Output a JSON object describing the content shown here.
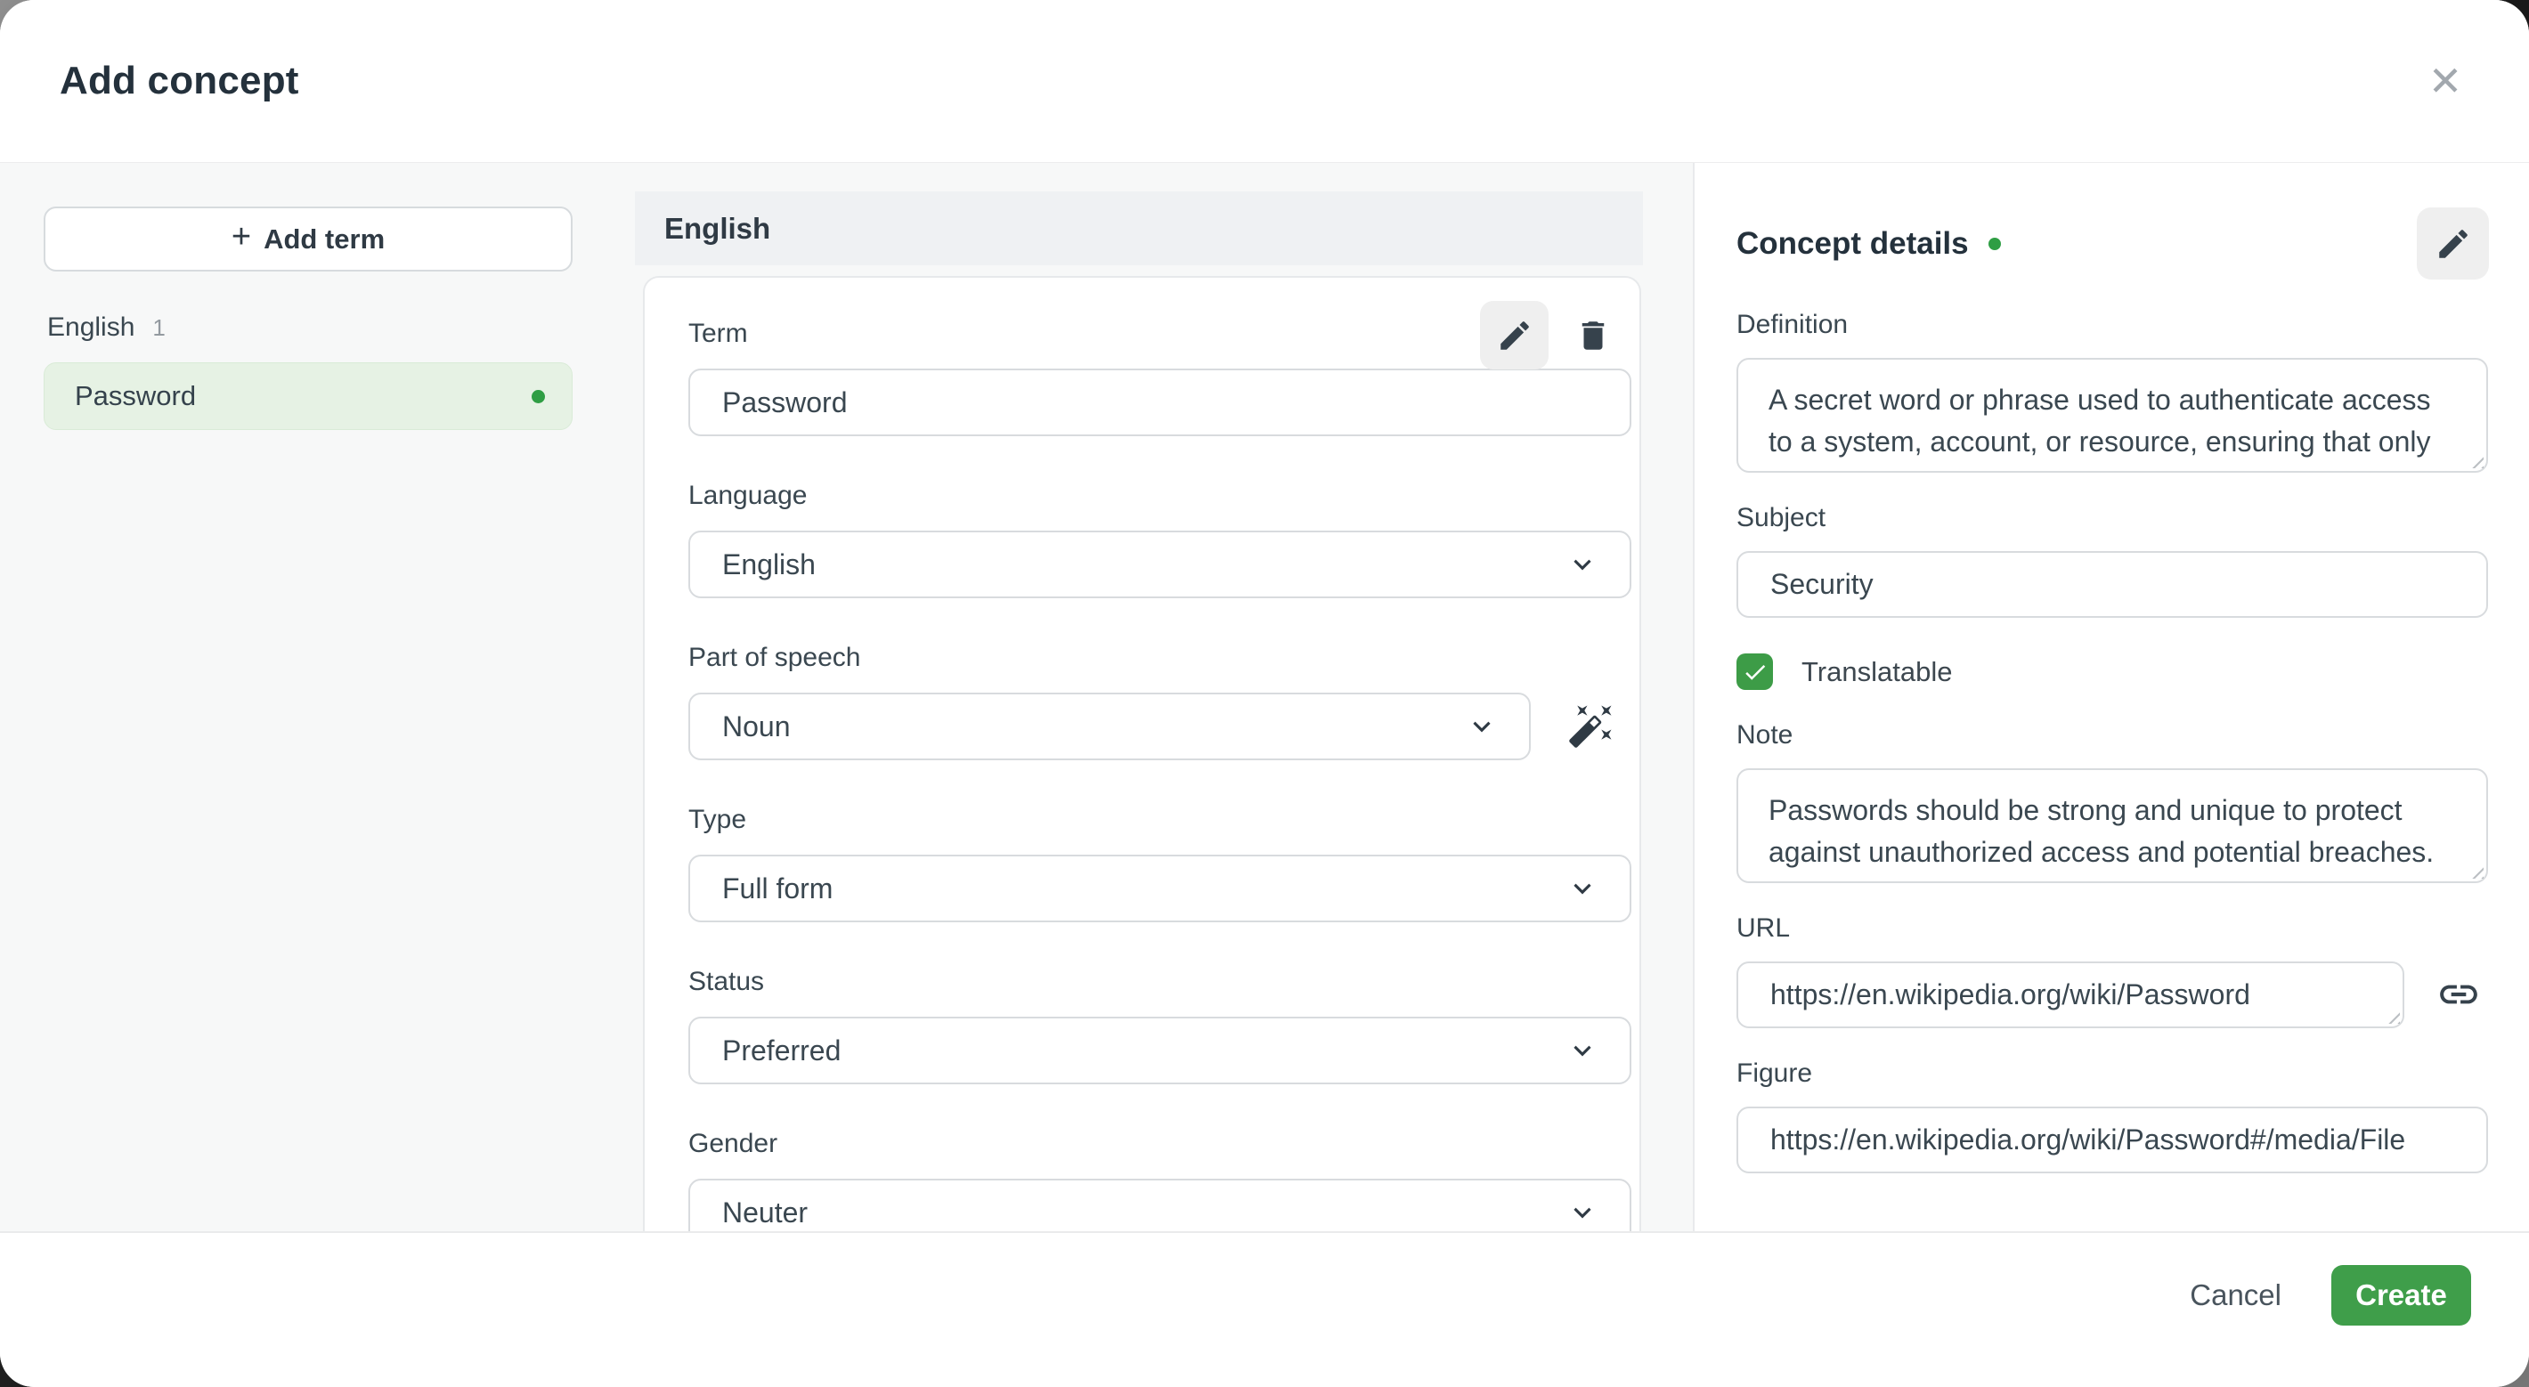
{
  "dialog": {
    "title": "Add concept",
    "close_glyph": "✕"
  },
  "sidebar": {
    "add_term": {
      "icon": "+",
      "label": "Add term"
    },
    "group": {
      "language": "English",
      "count": "1"
    },
    "terms": [
      {
        "label": "Password"
      }
    ]
  },
  "term_editor": {
    "header": "English",
    "term": {
      "label": "Term",
      "value": "Password"
    },
    "language": {
      "label": "Language",
      "value": "English"
    },
    "part_of_speech": {
      "label": "Part of speech",
      "value": "Noun"
    },
    "type": {
      "label": "Type",
      "value": "Full form"
    },
    "status": {
      "label": "Status",
      "value": "Preferred"
    },
    "gender": {
      "label": "Gender",
      "value": "Neuter"
    }
  },
  "concept_details": {
    "title": "Concept details",
    "definition": {
      "label": "Definition",
      "value": "A secret word or phrase used to authenticate access to a system, account, or resource, ensuring that only authorized users can gain entry."
    },
    "subject": {
      "label": "Subject",
      "value": "Security"
    },
    "translatable": {
      "label": "Translatable",
      "checked": true
    },
    "note": {
      "label": "Note",
      "value": "Passwords should be strong and unique to protect against unauthorized access and potential breaches."
    },
    "url": {
      "label": "URL",
      "value": "https://en.wikipedia.org/wiki/Password"
    },
    "figure": {
      "label": "Figure",
      "value": "https://en.wikipedia.org/wiki/Password#/media/File"
    }
  },
  "footer": {
    "cancel_label": "Cancel",
    "create_label": "Create"
  },
  "colors": {
    "accent_green": "#3f9e4a",
    "checkbox_green": "#3d9c47",
    "status_dot_green": "#2f9e44",
    "selected_term_bg": "#e6f2e4",
    "sidebar_bg": "#f7f8f8",
    "bar_bg": "#eff1f3",
    "text_dark": "#24313c"
  }
}
